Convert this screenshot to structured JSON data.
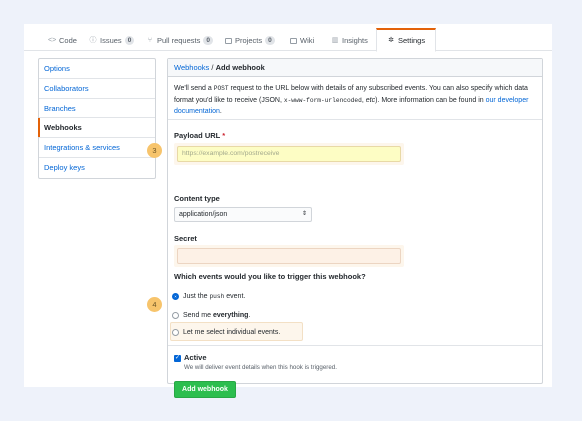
{
  "tabs": [
    {
      "icon": "code-icon",
      "label": "Code",
      "count": ""
    },
    {
      "icon": "issue-icon",
      "label": "Issues",
      "count": "0"
    },
    {
      "icon": "pull-request-icon",
      "label": "Pull requests",
      "count": "0"
    },
    {
      "icon": "project-icon",
      "label": "Projects",
      "count": "0"
    },
    {
      "icon": "wiki-icon",
      "label": "Wiki",
      "count": ""
    },
    {
      "icon": "graph-icon",
      "label": "Insights",
      "count": ""
    },
    {
      "icon": "gear-icon",
      "label": "Settings",
      "count": "",
      "selected": true
    }
  ],
  "sidebar": {
    "items": [
      {
        "label": "Options"
      },
      {
        "label": "Collaborators"
      },
      {
        "label": "Branches"
      },
      {
        "label": "Webhooks",
        "selected": true
      },
      {
        "label": "Integrations & services"
      },
      {
        "label": "Deploy keys"
      }
    ]
  },
  "panel": {
    "crumb_link": "Webhooks",
    "crumb_sep": " / ",
    "crumb_current": "Add webhook",
    "intro_1": "We'll send a ",
    "intro_code_1": "POST",
    "intro_2": " request to the URL below with details of any subscribed events. You can also specify which data format you'd like to receive (JSON, ",
    "intro_code_2": "x-www-form-urlencoded",
    "intro_3": ", ",
    "intro_etc": "etc",
    "intro_4": "). More information can be found in ",
    "intro_link": "our developer documentation",
    "intro_5": "."
  },
  "form": {
    "payload_label": "Payload URL",
    "required_mark": "*",
    "payload_placeholder": "https://example.com/postreceive",
    "content_type_label": "Content type",
    "content_type_value": "application/json",
    "secret_label": "Secret",
    "events_question": "Which events would you like to trigger this webhook?",
    "radio_push_prefix": "Just the ",
    "radio_push_code": "push",
    "radio_push_suffix": " event.",
    "radio_everything_prefix": "Send me ",
    "radio_everything_bold": "everything",
    "radio_everything_suffix": ".",
    "radio_individual": "Let me select individual events.",
    "active_label": "Active",
    "active_note": "We will deliver event details when this hook is triggered.",
    "submit_label": "Add webhook"
  },
  "annotations": {
    "badge_3": "3",
    "badge_4": "4"
  },
  "colors": {
    "accent": "#e36209",
    "link": "#0366d6",
    "primary_button": "#2cbe4e",
    "badge": "#f7c46c"
  }
}
